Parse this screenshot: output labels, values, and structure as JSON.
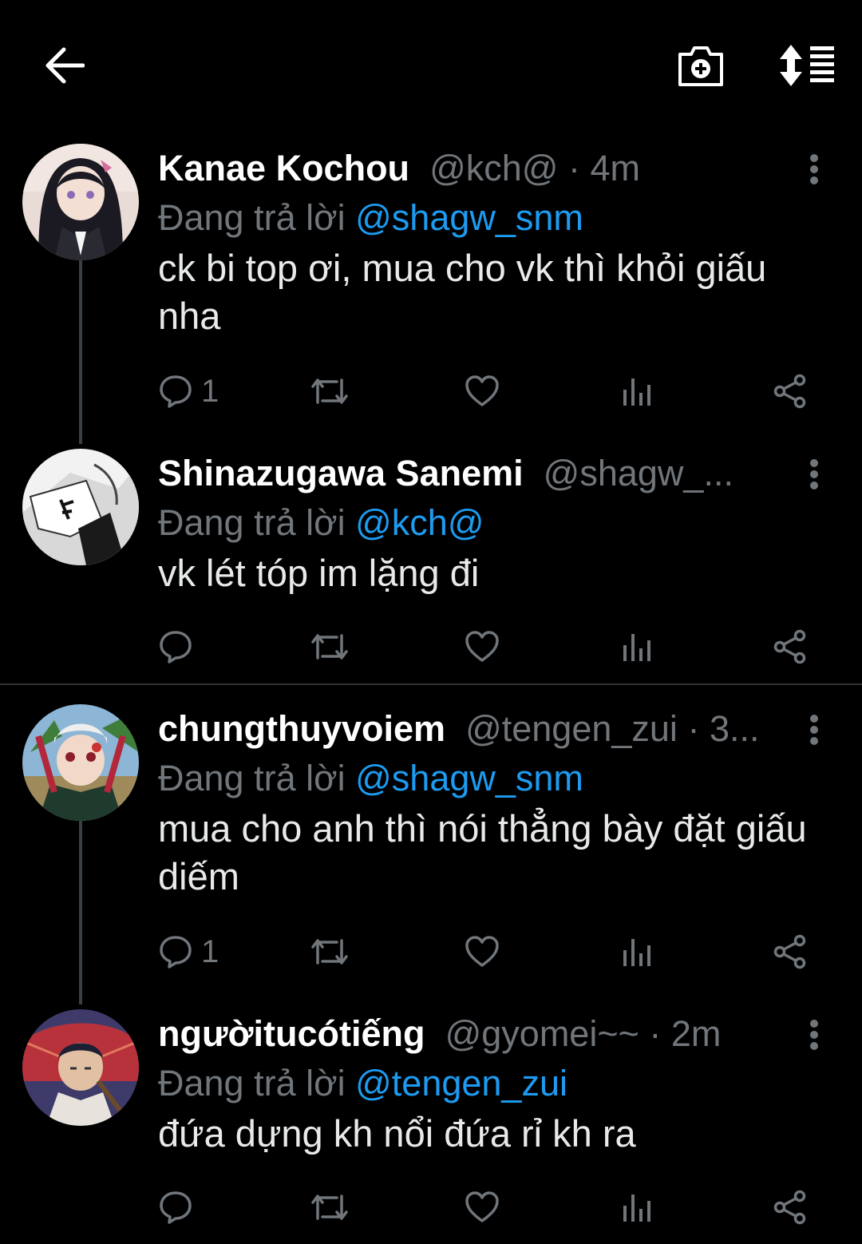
{
  "header": {
    "back_icon": "arrow-left-icon",
    "camera_icon": "camera-add-icon",
    "sort_icon": "sort-list-icon"
  },
  "tweets": [
    {
      "name": "Kanae Kochou",
      "handle": "@kch@",
      "sep": " · ",
      "time": "4m",
      "replying_prefix": "Đang trả lời ",
      "replying_to": "@shagw_snm",
      "text": "ck bi top ơi, mua cho vk thì khỏi giấu nha",
      "reply_count": "1"
    },
    {
      "name": "Shinazugawa Sanemi",
      "handle": "@shagw_...",
      "sep": "",
      "time": "",
      "replying_prefix": "Đang trả lời ",
      "replying_to": "@kch@",
      "text": "vk lét tóp im lặng đi",
      "reply_count": ""
    },
    {
      "name": "chungthuyvoiem",
      "handle": "@tengen_zui",
      "sep": " · ",
      "time": "3...",
      "replying_prefix": "Đang trả lời ",
      "replying_to": "@shagw_snm",
      "text": "mua cho anh thì nói thẳng bày đặt giấu diếm",
      "reply_count": "1"
    },
    {
      "name": "ngườitucótiếng",
      "handle": "@gyomei~~",
      "sep": " · ",
      "time": "2m",
      "replying_prefix": "Đang trả lời ",
      "replying_to": "@tengen_zui",
      "text": "đứa dựng kh nổi đứa rỉ kh ra",
      "reply_count": ""
    }
  ],
  "colors": {
    "background": "#000000",
    "primary_text": "#e7e9ea",
    "secondary_text": "#71767b",
    "link": "#1d9bf0",
    "thread_line": "#3a3f44"
  }
}
